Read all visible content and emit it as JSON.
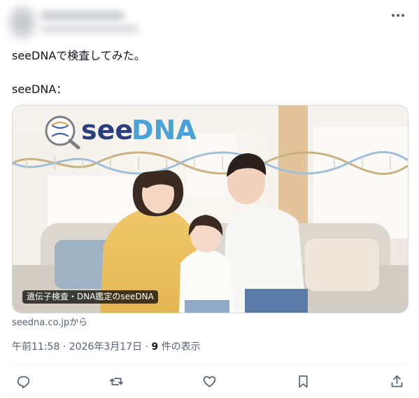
{
  "post": {
    "text_line1": "seeDNAで検査してみた。",
    "text_line2": "seeDNA："
  },
  "card": {
    "brand": "seeDNA",
    "title": "遺伝子検査・DNA鑑定のseeDNA",
    "source": "seedna.co.jpから"
  },
  "meta": {
    "time": "午前11:58",
    "separator": "·",
    "date": "2026年3月17日",
    "views_count": "9",
    "views_label": "件の表示"
  },
  "actions": {
    "icons": [
      "reply-icon",
      "repost-icon",
      "like-icon",
      "bookmark-icon",
      "share-icon"
    ]
  },
  "colors": {
    "text": "#0f1419",
    "secondary": "#536471",
    "border": "#cfd9de",
    "divider": "#eff3f4",
    "brand_navy": "#2b3f7e",
    "brand_blue": "#4aa3d8"
  }
}
